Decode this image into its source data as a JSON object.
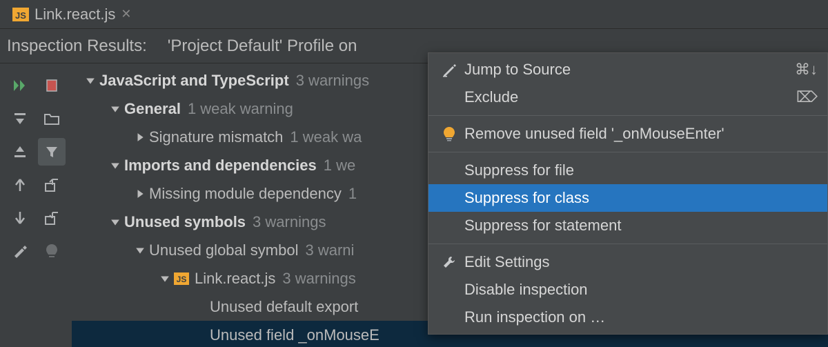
{
  "tab": {
    "filename": "Link.react.js",
    "icon_text": "JS"
  },
  "header": {
    "title": "Inspection Results:",
    "profile": "'Project Default' Profile on"
  },
  "tree": {
    "root": {
      "label": "JavaScript and TypeScript",
      "count": "3 warnings"
    },
    "general": {
      "label": "General",
      "count": "1 weak warning"
    },
    "sigmismatch": {
      "label": "Signature mismatch",
      "count": "1 weak wa"
    },
    "imports": {
      "label": "Imports and dependencies",
      "count": "1 we"
    },
    "missingmod": {
      "label": "Missing module dependency",
      "count": "1"
    },
    "unused": {
      "label": "Unused symbols",
      "count": "3 warnings"
    },
    "unusedglobal": {
      "label": "Unused global symbol",
      "count": "3 warni"
    },
    "file": {
      "label": "Link.react.js",
      "count": "3 warnings",
      "icon_text": "JS"
    },
    "unuseddefault": {
      "label": "Unused default export"
    },
    "unusedfield": {
      "label": "Unused field _onMouseE"
    }
  },
  "menu": {
    "jump": "Jump to Source",
    "jump_shortcut": "⌘↓",
    "exclude": "Exclude",
    "exclude_shortcut": "⌦",
    "remove": "Remove unused field '_onMouseEnter'",
    "sup_file": "Suppress for file",
    "sup_class": "Suppress for class",
    "sup_stmt": "Suppress for statement",
    "edit": "Edit Settings",
    "disable": "Disable inspection",
    "run": "Run inspection on …"
  }
}
